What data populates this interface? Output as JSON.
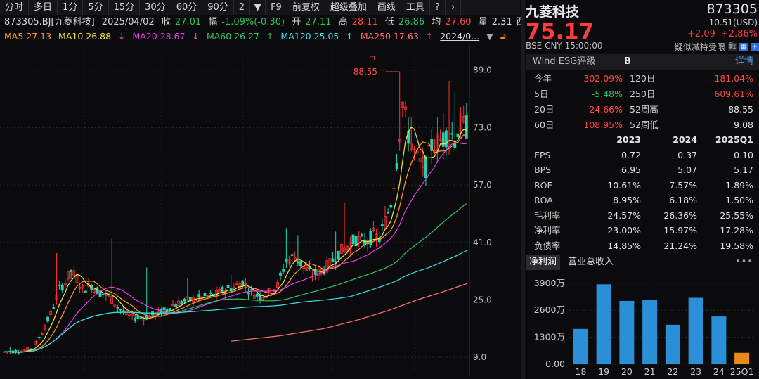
{
  "toolbar": {
    "items": [
      "分时",
      "多日",
      "1分",
      "5分",
      "15分",
      "30分",
      "60分",
      "90分",
      "2",
      "F9",
      "前复权",
      "超级叠加",
      "画线",
      "工具"
    ],
    "dropdown_icon": "caret-down-icon",
    "help_icon": "help-icon",
    "next_icon": "chevron-right-icon"
  },
  "info": {
    "title": "873305.BJ[九菱科技]",
    "date": "2025/04/02",
    "close_label": "收",
    "close": "27.01",
    "range_label": "幅",
    "range": "-1.09%(-0.30)",
    "open_label": "开",
    "open": "27.11",
    "high_label": "高",
    "high": "28.11",
    "low_label": "低",
    "low": "26.86",
    "avg_label": "均",
    "avg": "27.60",
    "vol_label": "量",
    "vol": "2.31",
    "vol_suffix": "西"
  },
  "ma": {
    "ma5": "MA5 27.13",
    "ma10": "MA10 26.88",
    "ma20": "MA20 28.67",
    "ma60": "MA60 26.27",
    "ma120": "MA120 25.05",
    "ma250": "MA250 17.63",
    "period": "2024/0..."
  },
  "chart_data": {
    "type": "candlestick",
    "y_ticks": [
      "89.0",
      "73.0",
      "57.0",
      "41.0",
      "25.0",
      "9.0"
    ],
    "y_tick_values": [
      89,
      73,
      57,
      41,
      25,
      9
    ],
    "ylim": [
      5.5,
      96
    ],
    "max_label": "88.55",
    "max_value": 88.55,
    "colors": {
      "up": "#ff3030",
      "down": "#1fd6b2",
      "ma5": "#f4e742",
      "ma10": "#ff9a2e",
      "ma20": "#e83be8",
      "ma60": "#33c46a",
      "ma120": "#39e0e8",
      "ma250": "#ff6f6f"
    },
    "close_path": [
      [
        0,
        10.5
      ],
      [
        6,
        10.8
      ],
      [
        10,
        11.5
      ],
      [
        13,
        16
      ],
      [
        16,
        21
      ],
      [
        19,
        28
      ],
      [
        21,
        30
      ],
      [
        23,
        33
      ],
      [
        25,
        31
      ],
      [
        27,
        28
      ],
      [
        30,
        29
      ],
      [
        33,
        27
      ],
      [
        36,
        26
      ],
      [
        39,
        23
      ],
      [
        42,
        21
      ],
      [
        45,
        20
      ],
      [
        48,
        20
      ],
      [
        52,
        21
      ],
      [
        55,
        22
      ],
      [
        58,
        23.5
      ],
      [
        61,
        24.5
      ],
      [
        64,
        25
      ],
      [
        67,
        25.5
      ],
      [
        70,
        26
      ],
      [
        73,
        26.5
      ],
      [
        76,
        28
      ],
      [
        79,
        28.5
      ],
      [
        82,
        30
      ],
      [
        85,
        27
      ],
      [
        88,
        26
      ],
      [
        91,
        27
      ],
      [
        94,
        29
      ],
      [
        97,
        36
      ],
      [
        100,
        37
      ],
      [
        103,
        34
      ],
      [
        106,
        32
      ],
      [
        109,
        33
      ],
      [
        112,
        35
      ],
      [
        115,
        38
      ],
      [
        118,
        40
      ],
      [
        121,
        42
      ],
      [
        124,
        41
      ],
      [
        127,
        43
      ],
      [
        129,
        42
      ],
      [
        131,
        47
      ],
      [
        133,
        52
      ],
      [
        135,
        64
      ],
      [
        137,
        80
      ],
      [
        139,
        71
      ],
      [
        141,
        66
      ],
      [
        143,
        63
      ],
      [
        145,
        62
      ],
      [
        147,
        68
      ],
      [
        149,
        69
      ],
      [
        151,
        70
      ],
      [
        153,
        72
      ],
      [
        155,
        70
      ],
      [
        157,
        74
      ],
      [
        159,
        73
      ]
    ],
    "spikes": [
      [
        2,
        12
      ],
      [
        18,
        38
      ],
      [
        37,
        42
      ],
      [
        49,
        34
      ],
      [
        63,
        31
      ],
      [
        78,
        32
      ],
      [
        97,
        45
      ],
      [
        101,
        43
      ],
      [
        114,
        44
      ],
      [
        117,
        52
      ],
      [
        134,
        60
      ],
      [
        136,
        88.55
      ],
      [
        138,
        78
      ],
      [
        140,
        76
      ],
      [
        143,
        68
      ],
      [
        149,
        76
      ],
      [
        151,
        77
      ],
      [
        153,
        86
      ],
      [
        155,
        83
      ],
      [
        158,
        79
      ]
    ],
    "ma250_path": [
      [
        78,
        13.5
      ],
      [
        95,
        15
      ],
      [
        110,
        17
      ],
      [
        122,
        19.5
      ],
      [
        132,
        22
      ],
      [
        142,
        25
      ],
      [
        150,
        27
      ],
      [
        159,
        29.5
      ]
    ]
  },
  "panel": {
    "name": "九菱科技",
    "code": "873305",
    "price": "75.17",
    "usd": "10.51(USD)",
    "change": "+2.09",
    "change_pct": "+2.86%",
    "exchange": "BSE",
    "currency": "CNY",
    "time": "15:00:00",
    "notice": "疑似减持受限",
    "margin_tag": "融",
    "icon_a": "grid-icon",
    "icon_b": "plus-icon",
    "esg_label": "Wind ESG评级",
    "esg_grade": "B",
    "esg_detail": "详情",
    "perf": [
      {
        "l1": "今年",
        "v1": "302.09%",
        "c1": "red",
        "l2": "120日",
        "v2": "181.04%",
        "c2": "red"
      },
      {
        "l1": "5日",
        "v1": "-5.48%",
        "c1": "green",
        "l2": "250日",
        "v2": "609.61%",
        "c2": "red"
      },
      {
        "l1": "20日",
        "v1": "24.66%",
        "c1": "red",
        "l2": "52周高",
        "v2": "88.55",
        "c2": "white"
      },
      {
        "l1": "60日",
        "v1": "108.95%",
        "c1": "red",
        "l2": "52周低",
        "v2": "9.08",
        "c2": "white"
      }
    ],
    "fin_header": [
      "2023",
      "2024",
      "2025Q1"
    ],
    "fin": [
      {
        "label": "EPS",
        "v": [
          "0.72",
          "0.37",
          "0.10"
        ]
      },
      {
        "label": "BPS",
        "v": [
          "6.95",
          "5.07",
          "5.17"
        ]
      },
      {
        "label": "ROE",
        "v": [
          "10.61%",
          "7.57%",
          "1.89%"
        ]
      },
      {
        "label": "ROA",
        "v": [
          "8.95%",
          "6.18%",
          "1.50%"
        ]
      },
      {
        "label": "毛利率",
        "v": [
          "24.57%",
          "26.36%",
          "25.55%"
        ]
      },
      {
        "label": "净利率",
        "v": [
          "23.00%",
          "15.97%",
          "17.28%"
        ]
      },
      {
        "label": "负债率",
        "v": [
          "14.85%",
          "21.24%",
          "19.58%"
        ]
      }
    ],
    "tabs": [
      "净利润",
      "营业总收入"
    ],
    "more": "•••"
  },
  "profit_chart": {
    "type": "bar",
    "categories": [
      "18",
      "19",
      "20",
      "21",
      "22",
      "23",
      "24",
      "25Q1"
    ],
    "values": [
      1700,
      3850,
      3050,
      3100,
      1900,
      3200,
      2300,
      550
    ],
    "y_ticks": [
      "3900万",
      "2600万",
      "1300万",
      "0.00"
    ],
    "y_tick_values": [
      3900,
      2600,
      1300,
      0
    ],
    "ylim": [
      0,
      4200
    ],
    "colors": {
      "normal": "#2a8fd6",
      "latest": "#e88a1a"
    }
  }
}
